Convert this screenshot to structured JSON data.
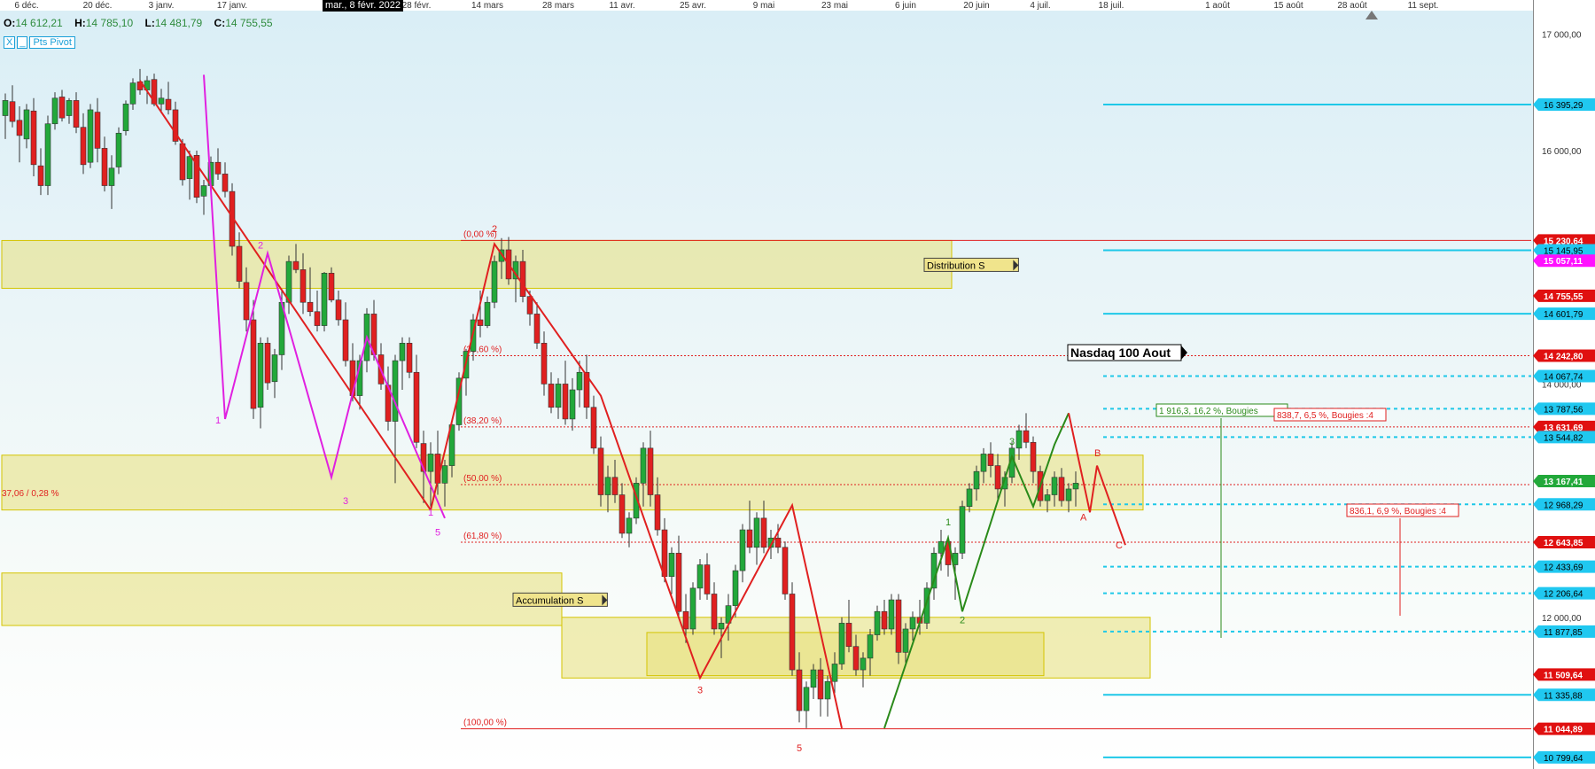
{
  "ohlc": {
    "o_label": "O:",
    "o": "14 612,21",
    "h_label": "H:",
    "h": "14 785,10",
    "l_label": "L:",
    "l": "14 481,79",
    "c_label": "C:",
    "c": "14 755,55"
  },
  "toolbar": {
    "close": "X",
    "minimize": "_",
    "indicator": "Pts Pivot"
  },
  "cursor_date": "mar., 8 févr. 2022",
  "colors": {
    "up": "#22a83a",
    "down": "#e02020",
    "zone_fill": "#e8e07a",
    "zone_border": "#d4c400",
    "cyan": "#1ec8e8",
    "pink": "#e020e0",
    "green_wave": "#2a8a1a",
    "red_line": "#e02020"
  },
  "chart_data": {
    "type": "candlestick",
    "ylim": [
      10700,
      17200
    ],
    "x_ticks": [
      {
        "label": "6 déc.",
        "i": 3
      },
      {
        "label": "20 déc.",
        "i": 13
      },
      {
        "label": "3 janv.",
        "i": 22
      },
      {
        "label": "17 janv.",
        "i": 32
      },
      {
        "label": "févr.",
        "i": 50
      },
      {
        "label": "28 févr.",
        "i": 58
      },
      {
        "label": "14 mars",
        "i": 68
      },
      {
        "label": "28 mars",
        "i": 78
      },
      {
        "label": "11 avr.",
        "i": 87
      },
      {
        "label": "25 avr.",
        "i": 97
      },
      {
        "label": "9 mai",
        "i": 107
      },
      {
        "label": "23 mai",
        "i": 117
      },
      {
        "label": "6 juin",
        "i": 127
      },
      {
        "label": "20 juin",
        "i": 137
      },
      {
        "label": "4 juil.",
        "i": 146
      },
      {
        "label": "18 juil.",
        "i": 156
      },
      {
        "label": "1 août",
        "i": 166
      },
      {
        "label": "15 août",
        "i": 176
      },
      {
        "label": "28 août",
        "i": 185
      },
      {
        "label": "11 sept.",
        "i": 195
      }
    ],
    "y_ticks": [
      {
        "label": "17 000,00",
        "y": 17000
      },
      {
        "label": "16 000,00",
        "y": 16000
      },
      {
        "label": "14 000,00",
        "y": 14000
      },
      {
        "label": "12 000,00",
        "y": 12000
      }
    ],
    "price_labels": [
      {
        "label": "16 395,29",
        "y": 16395.29,
        "style": "cyan"
      },
      {
        "label": "15 230,64",
        "y": 15230.64,
        "style": "red"
      },
      {
        "label": "15 145,95",
        "y": 15145.95,
        "style": "cyan"
      },
      {
        "label": "15 057,11",
        "y": 15057.11,
        "style": "magenta"
      },
      {
        "label": "14 755,55",
        "y": 14755.55,
        "style": "red"
      },
      {
        "label": "14 601,79",
        "y": 14601.79,
        "style": "cyan"
      },
      {
        "label": "14 242,80",
        "y": 14242.8,
        "style": "red"
      },
      {
        "label": "14 067,74",
        "y": 14067.74,
        "style": "cyan"
      },
      {
        "label": "13 787,56",
        "y": 13787.56,
        "style": "cyan"
      },
      {
        "label": "13 631,69",
        "y": 13631.69,
        "style": "red"
      },
      {
        "label": "13 544,82",
        "y": 13544.82,
        "style": "cyan"
      },
      {
        "label": "13 167,41",
        "y": 13167.41,
        "style": "green"
      },
      {
        "label": "12 968,29",
        "y": 12968.29,
        "style": "cyan"
      },
      {
        "label": "12 643,85",
        "y": 12643.85,
        "style": "red"
      },
      {
        "label": "12 433,69",
        "y": 12433.69,
        "style": "cyan"
      },
      {
        "label": "12 206,64",
        "y": 12206.64,
        "style": "cyan"
      },
      {
        "label": "11 877,85",
        "y": 11877.85,
        "style": "cyan"
      },
      {
        "label": "11 509,64",
        "y": 11509.64,
        "style": "red"
      },
      {
        "label": "11 335,88",
        "y": 11335.88,
        "style": "cyan"
      },
      {
        "label": "11 044,89",
        "y": 11044.89,
        "style": "red"
      },
      {
        "label": "10 799,64",
        "y": 10799.64,
        "style": "cyan"
      }
    ],
    "fib_levels": [
      {
        "label": "(0,00 %)",
        "y": 15230.64
      },
      {
        "label": "(23,60 %)",
        "y": 14242.8
      },
      {
        "label": "(38,20 %)",
        "y": 13631.69
      },
      {
        "label": "(50,00 %)",
        "y": 13137.76
      },
      {
        "label": "(61,80 %)",
        "y": 12643.85
      },
      {
        "label": "(100,00 %)",
        "y": 11044.89
      }
    ],
    "zones": [
      {
        "name": "distribution",
        "i0": 0,
        "i1": 134,
        "y0": 14820,
        "y1": 15230,
        "label": "Distribution S"
      },
      {
        "name": "accumulation",
        "i0": 0,
        "i1": 79,
        "y0": 11930,
        "y1": 12380,
        "label": "Accumulation S"
      },
      {
        "name": "mid-band",
        "i0": 0,
        "i1": 161,
        "y0": 12920,
        "y1": 13390,
        "label": ""
      },
      {
        "name": "low-box",
        "i0": 79,
        "i1": 162,
        "y0": 11480,
        "y1": 12000,
        "label": ""
      },
      {
        "name": "low-box-2",
        "i0": 91,
        "i1": 147,
        "y0": 11500,
        "y1": 11870,
        "label": ""
      }
    ],
    "annotations": {
      "title": "Nasdaq 100 Aout",
      "left_note": "37,06 / 0,28 %",
      "meas1": "1 916,3, 16,2 %, Bougies",
      "meas2": "838,7, 6,5 %, Bougies :4",
      "meas3": "836,1, 6,9 %, Bougies :4"
    },
    "wave_labels": [
      {
        "t": "1",
        "i": 30,
        "y": 13660,
        "c": "pink"
      },
      {
        "t": "2",
        "i": 36,
        "y": 15160,
        "c": "pink"
      },
      {
        "t": "3",
        "i": 48,
        "y": 12970,
        "c": "pink"
      },
      {
        "t": "1",
        "i": 60,
        "y": 12870,
        "c": "pink"
      },
      {
        "t": "5",
        "i": 61,
        "y": 12700,
        "c": "pink"
      },
      {
        "t": "2",
        "i": 69,
        "y": 15300,
        "c": "red"
      },
      {
        "t": "3",
        "i": 98,
        "y": 11350,
        "c": "red"
      },
      {
        "t": "5",
        "i": 112,
        "y": 10850,
        "c": "red"
      },
      {
        "t": "1",
        "i": 133,
        "y": 12790,
        "c": "green"
      },
      {
        "t": "2",
        "i": 135,
        "y": 11950,
        "c": "green"
      },
      {
        "t": "3",
        "i": 142,
        "y": 13480,
        "c": "green"
      },
      {
        "t": "A",
        "i": 152,
        "y": 12830,
        "c": "red"
      },
      {
        "t": "B",
        "i": 154,
        "y": 13380,
        "c": "red"
      },
      {
        "t": "C",
        "i": 157,
        "y": 12590,
        "c": "red"
      }
    ],
    "candles": [
      [
        16300,
        16490,
        16100,
        16430
      ],
      [
        16420,
        16560,
        16200,
        16250
      ],
      [
        16260,
        16380,
        15900,
        16130
      ],
      [
        16100,
        16400,
        16020,
        16350
      ],
      [
        16340,
        16450,
        15780,
        15880
      ],
      [
        15870,
        16020,
        15620,
        15700
      ],
      [
        15700,
        16300,
        15620,
        16230
      ],
      [
        16230,
        16500,
        16180,
        16450
      ],
      [
        16460,
        16520,
        16250,
        16280
      ],
      [
        16300,
        16450,
        16230,
        16430
      ],
      [
        16430,
        16500,
        16150,
        16200
      ],
      [
        16200,
        16320,
        15800,
        15880
      ],
      [
        15900,
        16400,
        15850,
        16350
      ],
      [
        16330,
        16450,
        15900,
        16020
      ],
      [
        16020,
        16120,
        15650,
        15700
      ],
      [
        15700,
        15960,
        15500,
        15850
      ],
      [
        15860,
        16200,
        15800,
        16150
      ],
      [
        16170,
        16430,
        16130,
        16400
      ],
      [
        16400,
        16620,
        16350,
        16580
      ],
      [
        16590,
        16700,
        16480,
        16520
      ],
      [
        16520,
        16640,
        16400,
        16600
      ],
      [
        16610,
        16660,
        16380,
        16400
      ],
      [
        16400,
        16530,
        16320,
        16450
      ],
      [
        16440,
        16590,
        16310,
        16350
      ],
      [
        16350,
        16420,
        16050,
        16080
      ],
      [
        16060,
        16100,
        15700,
        15750
      ],
      [
        15760,
        16000,
        15580,
        15950
      ],
      [
        15960,
        16000,
        15550,
        15600
      ],
      [
        15610,
        15750,
        15450,
        15700
      ],
      [
        15700,
        15950,
        15650,
        15900
      ],
      [
        15900,
        16020,
        15750,
        15800
      ],
      [
        15800,
        15900,
        15600,
        15650
      ],
      [
        15650,
        15720,
        15100,
        15180
      ],
      [
        15180,
        15300,
        14820,
        14880
      ],
      [
        14870,
        15000,
        14450,
        14550
      ],
      [
        14550,
        14720,
        13700,
        13790
      ],
      [
        13800,
        14400,
        13620,
        14350
      ],
      [
        14350,
        14400,
        13950,
        14010
      ],
      [
        14020,
        14300,
        13880,
        14250
      ],
      [
        14250,
        14800,
        14120,
        14700
      ],
      [
        14700,
        15100,
        14600,
        15050
      ],
      [
        15050,
        15200,
        14950,
        14980
      ],
      [
        14980,
        15120,
        14600,
        14700
      ],
      [
        14700,
        15000,
        14580,
        14620
      ],
      [
        14620,
        14800,
        14450,
        14500
      ],
      [
        14500,
        14960,
        14450,
        14950
      ],
      [
        14950,
        15000,
        14700,
        14720
      ],
      [
        14720,
        14800,
        14500,
        14550
      ],
      [
        14550,
        14700,
        14150,
        14200
      ],
      [
        14200,
        14350,
        13850,
        13900
      ],
      [
        13900,
        14250,
        13780,
        14200
      ],
      [
        14200,
        14650,
        14100,
        14600
      ],
      [
        14600,
        14720,
        14200,
        14250
      ],
      [
        14250,
        14350,
        13950,
        14000
      ],
      [
        13990,
        14150,
        13600,
        13680
      ],
      [
        13680,
        14250,
        13150,
        14200
      ],
      [
        14200,
        14400,
        13950,
        14350
      ],
      [
        14350,
        14400,
        14050,
        14100
      ],
      [
        14100,
        14250,
        13450,
        13500
      ],
      [
        13490,
        13600,
        12980,
        13250
      ],
      [
        13250,
        13500,
        12950,
        13400
      ],
      [
        13400,
        13600,
        13050,
        13150
      ],
      [
        13150,
        13350,
        12950,
        13300
      ],
      [
        13300,
        13700,
        13200,
        13650
      ],
      [
        13650,
        14100,
        13600,
        14050
      ],
      [
        14050,
        14300,
        13900,
        14280
      ],
      [
        14280,
        14600,
        14200,
        14550
      ],
      [
        14550,
        14800,
        14400,
        14500
      ],
      [
        14500,
        14750,
        14480,
        14700
      ],
      [
        14700,
        15100,
        14650,
        15050
      ],
      [
        15050,
        15250,
        14900,
        15150
      ],
      [
        15150,
        15260,
        14850,
        14900
      ],
      [
        14900,
        15100,
        14700,
        15050
      ],
      [
        15050,
        15150,
        14700,
        14750
      ],
      [
        14750,
        14800,
        14500,
        14600
      ],
      [
        14600,
        14700,
        14300,
        14350
      ],
      [
        14350,
        14450,
        13900,
        14000
      ],
      [
        14000,
        14100,
        13750,
        13800
      ],
      [
        13800,
        14050,
        13700,
        14000
      ],
      [
        14000,
        14200,
        13650,
        13700
      ],
      [
        13700,
        14050,
        13600,
        13950
      ],
      [
        13950,
        14200,
        13800,
        14100
      ],
      [
        14100,
        14250,
        13700,
        13800
      ],
      [
        13800,
        13900,
        13400,
        13450
      ],
      [
        13450,
        13550,
        12950,
        13050
      ],
      [
        13050,
        13300,
        12900,
        13200
      ],
      [
        13200,
        13350,
        12980,
        13050
      ],
      [
        13050,
        13150,
        12680,
        12720
      ],
      [
        12720,
        12900,
        12600,
        12850
      ],
      [
        12850,
        13200,
        12800,
        13150
      ],
      [
        13150,
        13500,
        12950,
        13450
      ],
      [
        13450,
        13600,
        12950,
        13050
      ],
      [
        13050,
        13200,
        12700,
        12750
      ],
      [
        12750,
        12850,
        12300,
        12350
      ],
      [
        12350,
        12600,
        12200,
        12550
      ],
      [
        12550,
        12700,
        12000,
        12050
      ],
      [
        12050,
        12200,
        11780,
        11900
      ],
      [
        11900,
        12300,
        11850,
        12250
      ],
      [
        12250,
        12500,
        12150,
        12450
      ],
      [
        12450,
        12550,
        12150,
        12200
      ],
      [
        12200,
        12300,
        11850,
        11900
      ],
      [
        11900,
        12000,
        11650,
        11950
      ],
      [
        11950,
        12200,
        11800,
        12100
      ],
      [
        12100,
        12450,
        12000,
        12400
      ],
      [
        12400,
        12800,
        12300,
        12750
      ],
      [
        12750,
        13000,
        12550,
        12600
      ],
      [
        12600,
        12900,
        12450,
        12850
      ],
      [
        12850,
        13000,
        12550,
        12600
      ],
      [
        12600,
        12750,
        12500,
        12680
      ],
      [
        12680,
        12800,
        12550,
        12600
      ],
      [
        12600,
        12650,
        12150,
        12200
      ],
      [
        12200,
        12300,
        11500,
        11550
      ],
      [
        11550,
        11700,
        11100,
        11200
      ],
      [
        11200,
        11450,
        11050,
        11400
      ],
      [
        11400,
        11600,
        11300,
        11550
      ],
      [
        11550,
        11650,
        11150,
        11300
      ],
      [
        11300,
        11500,
        11150,
        11450
      ],
      [
        11450,
        11700,
        11350,
        11600
      ],
      [
        11600,
        12000,
        11550,
        11950
      ],
      [
        11950,
        12150,
        11700,
        11750
      ],
      [
        11750,
        11850,
        11500,
        11550
      ],
      [
        11550,
        11700,
        11400,
        11650
      ],
      [
        11650,
        11900,
        11500,
        11850
      ],
      [
        11850,
        12100,
        11800,
        12050
      ],
      [
        12050,
        12150,
        11850,
        11900
      ],
      [
        11900,
        12200,
        11850,
        12150
      ],
      [
        12150,
        12200,
        11600,
        11700
      ],
      [
        11700,
        11950,
        11600,
        11900
      ],
      [
        11900,
        12050,
        11800,
        12000
      ],
      [
        12000,
        12150,
        11850,
        11950
      ],
      [
        11950,
        12300,
        11900,
        12250
      ],
      [
        12250,
        12600,
        12150,
        12550
      ],
      [
        12550,
        12750,
        12400,
        12650
      ],
      [
        12650,
        12700,
        12350,
        12450
      ],
      [
        12450,
        12600,
        12150,
        12550
      ],
      [
        12550,
        13000,
        12500,
        12950
      ],
      [
        12950,
        13150,
        12900,
        13100
      ],
      [
        13100,
        13300,
        13000,
        13250
      ],
      [
        13250,
        13450,
        13150,
        13400
      ],
      [
        13400,
        13500,
        13200,
        13300
      ],
      [
        13300,
        13400,
        13000,
        13100
      ],
      [
        13100,
        13250,
        12950,
        13200
      ],
      [
        13200,
        13500,
        13150,
        13450
      ],
      [
        13450,
        13650,
        13350,
        13600
      ],
      [
        13600,
        13750,
        13450,
        13500
      ],
      [
        13500,
        13550,
        13150,
        13250
      ],
      [
        13250,
        13300,
        12950,
        13000
      ],
      [
        13000,
        13100,
        12900,
        13050
      ],
      [
        13050,
        13250,
        12950,
        13200
      ],
      [
        13200,
        13280,
        12950,
        13000
      ],
      [
        13000,
        13150,
        12900,
        13100
      ],
      [
        13100,
        13250,
        12950,
        13150
      ]
    ]
  }
}
